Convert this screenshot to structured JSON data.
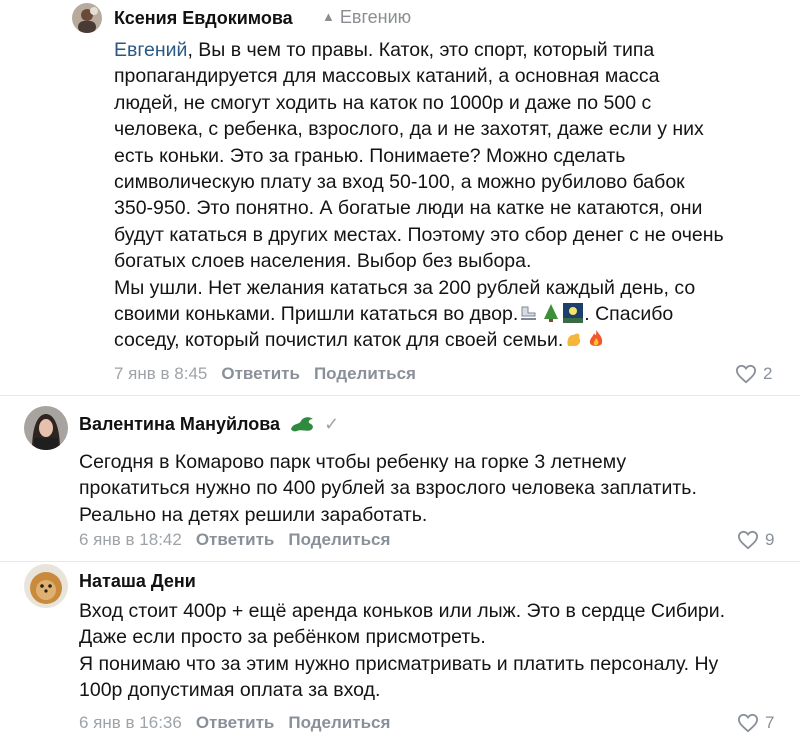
{
  "comments": [
    {
      "author": "Ксения Евдокимова",
      "reply_to": "Евгению",
      "mention": "Евгений",
      "text": ", Вы в чем то правы. Каток, это спорт, который типа\nпропагандируется для массовых катаний, а основная масса\nлюдей, не смогут ходить на каток по 1000р и даже по 500 с\nчеловека, с ребенка, взрослого, да и не захотят, даже если у них\nесть коньки. Это за гранью. Понимаете? Можно сделать\nсимволическую плату за вход 50-100, а можно рубилово бабок\n350-950. Это понятно. А богатые люди на катке не катаются, они\nбудут кататься в других местах. Поэтому это сбор денег с не очень\nбогатых слоев населения. Выбор без выбора.\nМы ушли. Нет желания кататься за 200 рублей каждый день, со\nсвоими коньками. Пришли кататься во двор.",
      "text_after_emoji": ". Спасибо\nсоседу, который почистил каток для своей семьи.",
      "date": "7 янв в 8:45",
      "reply_label": "Ответить",
      "share_label": "Поделиться",
      "likes": "2"
    },
    {
      "author": "Валентина Мануйлова",
      "text": "Сегодня в Комарово парк чтобы ребенку на горке 3 летнему\nпрокатиться нужно по 400 рублей за взрослого человека заплатить.\nРеально на детях решили заработать.",
      "date": "6 янв в 18:42",
      "reply_label": "Ответить",
      "share_label": "Поделиться",
      "likes": "9"
    },
    {
      "author": "Наташа Дени",
      "text": "Вход стоит 400р + ещё аренда коньков или лыж. Это в сердце Сибири.\nДаже если просто за ребёнком присмотреть.\nЯ понимаю что за этим нужно присматривать и платить персоналу. Ну\n100р допустимая оплата за вход.",
      "date": "6 янв в 16:36",
      "reply_label": "Ответить",
      "share_label": "Поделиться",
      "likes": "7"
    }
  ],
  "icons": {
    "reply_arrow": "reply-arrow-icon",
    "like": "heart-icon",
    "verified": "check-icon",
    "dragon": "dragon-emoji-icon"
  },
  "colors": {
    "mention": "#2a5885",
    "meta": "#9ea3a8",
    "action": "#8a9099"
  }
}
